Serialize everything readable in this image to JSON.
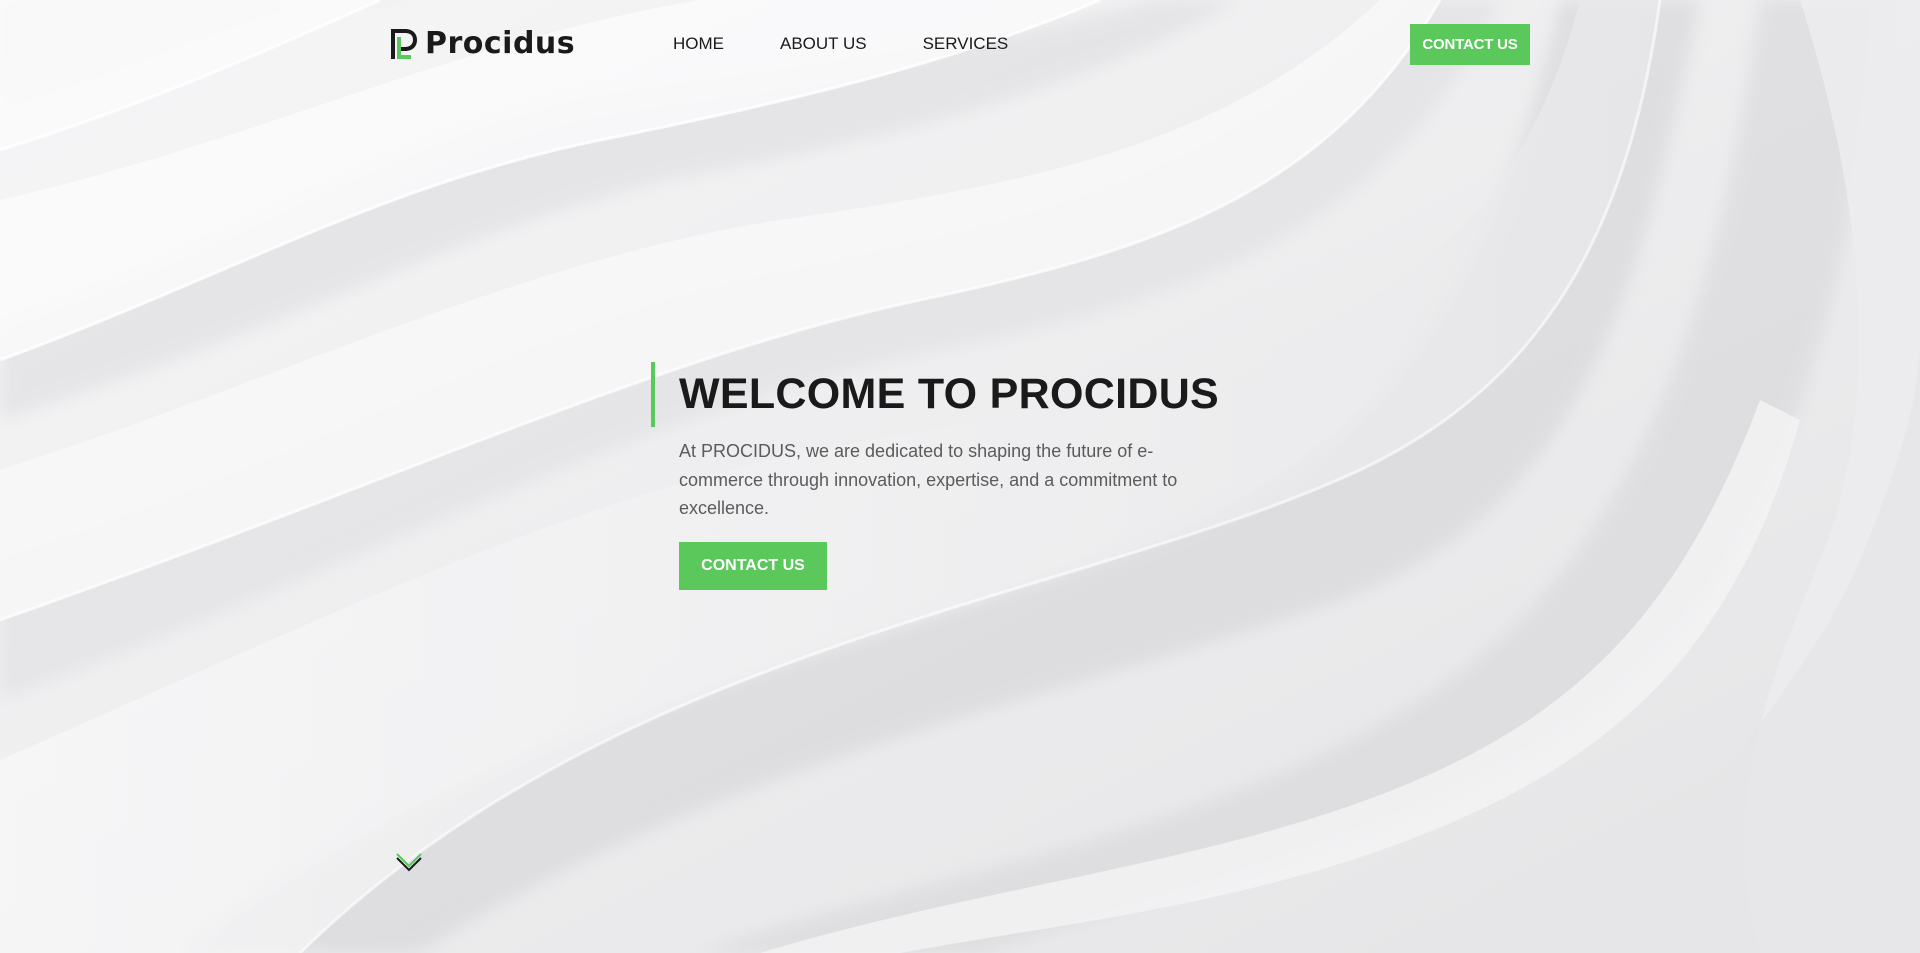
{
  "brand": {
    "name": "Procidus",
    "logo_icon": "procidus-logo-mark",
    "accent_color": "#5ac85a",
    "text_color": "#1a1a1a"
  },
  "nav": {
    "items": [
      {
        "label": "HOME"
      },
      {
        "label": "ABOUT US"
      },
      {
        "label": "SERVICES"
      }
    ],
    "cta_label": "CONTACT US"
  },
  "hero": {
    "title": "WELCOME TO PROCIDUS",
    "description": "At PROCIDUS, we are dedicated to shaping the future of e-commerce through innovation, expertise, and a commitment to excellence.",
    "cta_label": "CONTACT US"
  },
  "scroll": {
    "icon": "chevron-down-icon"
  }
}
